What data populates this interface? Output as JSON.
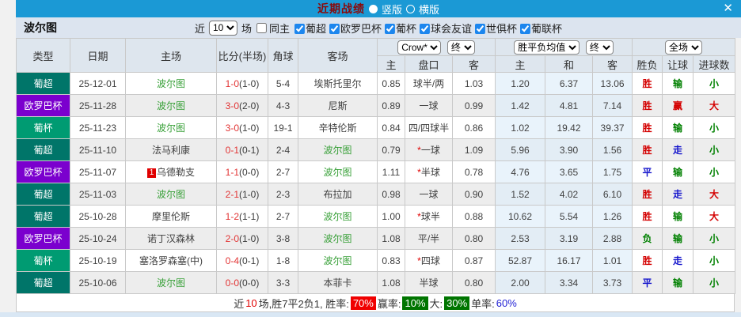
{
  "titlebar": {
    "title": "近期战绩",
    "vertical_label": "竖版",
    "horizontal_label": "横版",
    "close": "✕"
  },
  "filterbar": {
    "team": "波尔图",
    "near_label": "近",
    "count_value": "10",
    "field_label": "场",
    "same_home": {
      "label": "同主",
      "checked": false
    },
    "leagues": [
      {
        "label": "葡超",
        "checked": true
      },
      {
        "label": "欧罗巴杯",
        "checked": true
      },
      {
        "label": "葡杯",
        "checked": true
      },
      {
        "label": "球会友谊",
        "checked": true
      },
      {
        "label": "世俱杯",
        "checked": true
      },
      {
        "label": "葡联杯",
        "checked": true
      }
    ]
  },
  "table": {
    "headers": {
      "type": "类型",
      "date": "日期",
      "home": "主场",
      "score": "比分(半场)",
      "corner": "角球",
      "away": "客场"
    },
    "odds_company": "Crow*",
    "odds_period": "终",
    "avg_label": "胜平负均值",
    "avg_period": "终",
    "scope": "全场",
    "sub_headers": [
      "主",
      "盘口",
      "客",
      "主",
      "和",
      "客",
      "胜负",
      "让球",
      "进球数"
    ],
    "rows": [
      {
        "league": "葡超",
        "date": "25-12-01",
        "home": "波尔图",
        "home_hl": true,
        "home_rank": "",
        "score": "1-0",
        "half": "(1-0)",
        "corners": "5-4",
        "away": "埃斯托里尔",
        "away_hl": false,
        "water_home": "0.85",
        "handicap": "球半/两",
        "handicap_star": false,
        "water_away": "1.03",
        "avg_home": "1.20",
        "avg_draw": "6.37",
        "avg_away": "13.06",
        "outcome": "胜",
        "handicap_outcome": "输",
        "goal_outcome": "小"
      },
      {
        "league": "欧罗巴杯",
        "date": "25-11-28",
        "home": "波尔图",
        "home_hl": true,
        "home_rank": "",
        "score": "3-0",
        "half": "(2-0)",
        "corners": "4-3",
        "away": "尼斯",
        "away_hl": false,
        "water_home": "0.89",
        "handicap": "一球",
        "handicap_star": false,
        "water_away": "0.99",
        "avg_home": "1.42",
        "avg_draw": "4.81",
        "avg_away": "7.14",
        "outcome": "胜",
        "handicap_outcome": "赢",
        "goal_outcome": "大"
      },
      {
        "league": "葡杯",
        "date": "25-11-23",
        "home": "波尔图",
        "home_hl": true,
        "home_rank": "",
        "score": "3-0",
        "half": "(1-0)",
        "corners": "19-1",
        "away": "辛特伦斯",
        "away_hl": false,
        "water_home": "0.84",
        "handicap": "四/四球半",
        "handicap_star": false,
        "water_away": "0.86",
        "avg_home": "1.02",
        "avg_draw": "19.42",
        "avg_away": "39.37",
        "outcome": "胜",
        "handicap_outcome": "输",
        "goal_outcome": "小"
      },
      {
        "league": "葡超",
        "date": "25-11-10",
        "home": "法马利康",
        "home_hl": false,
        "home_rank": "",
        "score": "0-1",
        "half": "(0-1)",
        "corners": "2-4",
        "away": "波尔图",
        "away_hl": true,
        "water_home": "0.79",
        "handicap": "一球",
        "handicap_star": true,
        "water_away": "1.09",
        "avg_home": "5.96",
        "avg_draw": "3.90",
        "avg_away": "1.56",
        "outcome": "胜",
        "handicap_outcome": "走",
        "goal_outcome": "小"
      },
      {
        "league": "欧罗巴杯",
        "date": "25-11-07",
        "home": "乌德勒支",
        "home_hl": false,
        "home_rank": "1",
        "score": "1-1",
        "half": "(0-0)",
        "corners": "2-7",
        "away": "波尔图",
        "away_hl": true,
        "water_home": "1.11",
        "handicap": "半球",
        "handicap_star": true,
        "water_away": "0.78",
        "avg_home": "4.76",
        "avg_draw": "3.65",
        "avg_away": "1.75",
        "outcome": "平",
        "handicap_outcome": "输",
        "goal_outcome": "小"
      },
      {
        "league": "葡超",
        "date": "25-11-03",
        "home": "波尔图",
        "home_hl": true,
        "home_rank": "",
        "score": "2-1",
        "half": "(1-0)",
        "corners": "2-3",
        "away": "布拉加",
        "away_hl": false,
        "water_home": "0.98",
        "handicap": "一球",
        "handicap_star": false,
        "water_away": "0.90",
        "avg_home": "1.52",
        "avg_draw": "4.02",
        "avg_away": "6.10",
        "outcome": "胜",
        "handicap_outcome": "走",
        "goal_outcome": "大"
      },
      {
        "league": "葡超",
        "date": "25-10-28",
        "home": "摩里伦斯",
        "home_hl": false,
        "home_rank": "",
        "score": "1-2",
        "half": "(1-1)",
        "corners": "2-7",
        "away": "波尔图",
        "away_hl": true,
        "water_home": "1.00",
        "handicap": "球半",
        "handicap_star": true,
        "water_away": "0.88",
        "avg_home": "10.62",
        "avg_draw": "5.54",
        "avg_away": "1.26",
        "outcome": "胜",
        "handicap_outcome": "输",
        "goal_outcome": "大"
      },
      {
        "league": "欧罗巴杯",
        "date": "25-10-24",
        "home": "诺丁汉森林",
        "home_hl": false,
        "home_rank": "",
        "score": "2-0",
        "half": "(1-0)",
        "corners": "3-8",
        "away": "波尔图",
        "away_hl": true,
        "water_home": "1.08",
        "handicap": "平/半",
        "handicap_star": false,
        "water_away": "0.80",
        "avg_home": "2.53",
        "avg_draw": "3.19",
        "avg_away": "2.88",
        "outcome": "负",
        "handicap_outcome": "输",
        "goal_outcome": "小"
      },
      {
        "league": "葡杯",
        "date": "25-10-19",
        "home": "塞洛罗森塞(中)",
        "home_hl": false,
        "home_rank": "",
        "score": "0-4",
        "half": "(0-1)",
        "corners": "1-8",
        "away": "波尔图",
        "away_hl": true,
        "water_home": "0.83",
        "handicap": "四球",
        "handicap_star": true,
        "water_away": "0.87",
        "avg_home": "52.87",
        "avg_draw": "16.17",
        "avg_away": "1.01",
        "outcome": "胜",
        "handicap_outcome": "走",
        "goal_outcome": "小"
      },
      {
        "league": "葡超",
        "date": "25-10-06",
        "home": "波尔图",
        "home_hl": true,
        "home_rank": "",
        "score": "0-0",
        "half": "(0-0)",
        "corners": "3-3",
        "away": "本菲卡",
        "away_hl": false,
        "water_home": "1.08",
        "handicap": "半球",
        "handicap_star": false,
        "water_away": "0.80",
        "avg_home": "2.00",
        "avg_draw": "3.34",
        "avg_away": "3.73",
        "outcome": "平",
        "handicap_outcome": "输",
        "goal_outcome": "小"
      }
    ]
  },
  "summary": {
    "near": "近",
    "count": "10",
    "record": "场,胜7平2负1, 胜率:",
    "win_rate": "70%",
    "profit_label": "赢率:",
    "profit_rate": "10%",
    "big_label": "大:",
    "big_rate": "30%",
    "single_label": "单率:",
    "single_rate": "60%"
  },
  "colors": {
    "league": {
      "葡超": "#007569",
      "欧罗巴杯": "#7b00ce",
      "葡杯": "#009b72"
    },
    "verdict": {
      "胜": "#d40000",
      "平": "#1515cc",
      "负": "#008000",
      "赢": "#d40000",
      "走": "#1515cc",
      "输": "#008000",
      "大": "#d40000",
      "小": "#008000"
    },
    "team_highlight": "#38a038",
    "titlebar": "#1b99d5"
  }
}
